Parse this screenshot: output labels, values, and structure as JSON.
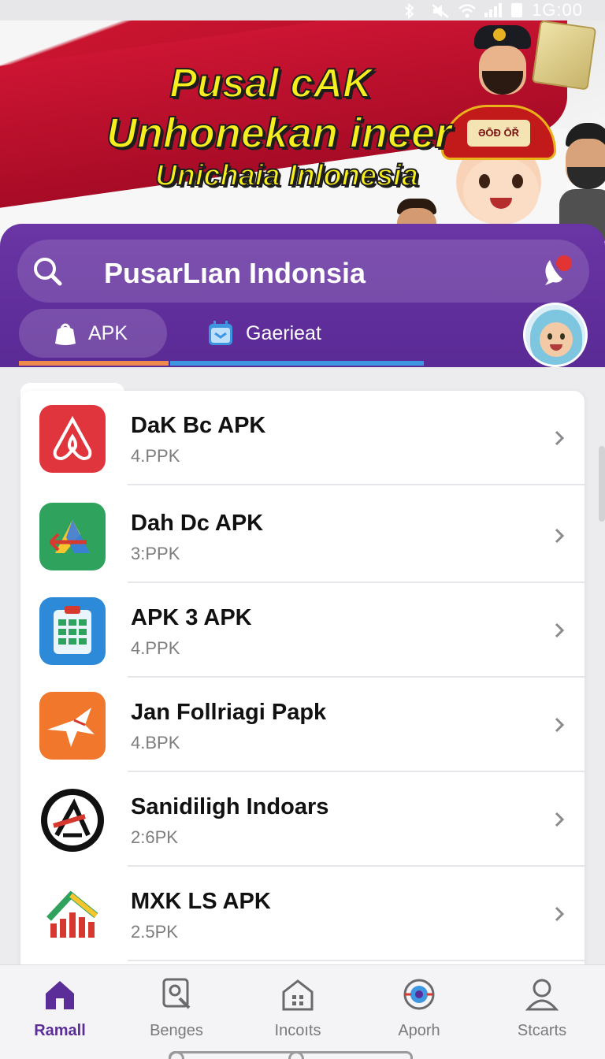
{
  "status_bar": {
    "time": "1G:00",
    "icons": [
      "bluetooth-icon",
      "mute-icon",
      "wifi-icon",
      "signal-icon",
      "battery-icon"
    ]
  },
  "banner": {
    "line1": "Pusal cAK",
    "line2": "Unhonekan ineer",
    "line3": "Unichaia Inlonesia",
    "hat_label": "ƏŌĐ ŌŘ"
  },
  "search": {
    "text": "PusarLıan Indonsia",
    "left_icon": "search-icon",
    "right_icon": "chat-bubble-icon"
  },
  "tabs": [
    {
      "label": "APK",
      "icon": "bag-icon",
      "active": true
    },
    {
      "label": "Gaerieat",
      "icon": "calendar-icon",
      "active": false
    }
  ],
  "list": {
    "items": [
      {
        "name": "DaK Bc APK",
        "size": "4.PPK",
        "icon": "airbnb-style-icon",
        "color": "#e0353d"
      },
      {
        "name": "Dah  Dc APK",
        "size": "3:PPK",
        "icon": "drive-style-icon",
        "color": "#2fa35e"
      },
      {
        "name": "APK 3 APK",
        "size": "4.PPK",
        "icon": "clipboard-grid-icon",
        "color": "#2c8ad8"
      },
      {
        "name": "Jan Follriagi Papk",
        "size": "4.BPK",
        "icon": "bird-icon",
        "color": "#f0772c"
      },
      {
        "name": "Sanidiligh Indoars",
        "size": "2:6PK",
        "icon": "triangle-a-icon",
        "color": "#111111"
      },
      {
        "name": "MXK LS APK",
        "size": "2.5PK",
        "icon": "bar-chart-arrow-icon",
        "color": "#d6372f"
      }
    ]
  },
  "bottom_nav": [
    {
      "label": "Ramall",
      "icon": "home-icon",
      "active": true
    },
    {
      "label": "Benges",
      "icon": "badge-icon",
      "active": false
    },
    {
      "label": "Incoıts",
      "icon": "house-grid-icon",
      "active": false
    },
    {
      "label": "Aporh",
      "icon": "target-icon",
      "active": false
    },
    {
      "label": "Stcarts",
      "icon": "person-icon",
      "active": false
    }
  ],
  "colors": {
    "accent": "#5b2d98",
    "panel": "#6a35a4",
    "tab_orange": "#ef8a4f",
    "tab_blue": "#3f96e0"
  }
}
